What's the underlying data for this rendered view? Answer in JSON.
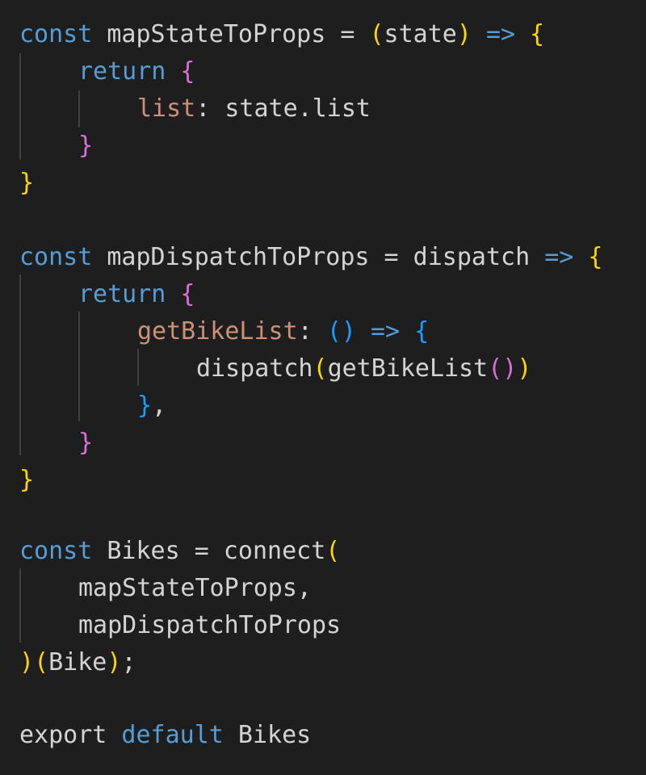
{
  "code": {
    "l1": {
      "kw": "const",
      "rest": " mapStateToProps = ",
      "p1": "(",
      "param": "state",
      "p2": ")",
      "arrow": " =>",
      "brace": " {"
    },
    "l2": {
      "kw": "return",
      "brace": " {"
    },
    "l3": {
      "prop": "list",
      "rest": ": state.list"
    },
    "l4": {
      "brace": "}"
    },
    "l5": {
      "brace": "}"
    },
    "l7": {
      "kw": "const",
      "rest": " mapDispatchToProps = dispatch ",
      "arrow": "=>",
      "brace": " {"
    },
    "l8": {
      "kw": "return",
      "brace": " {"
    },
    "l9": {
      "prop": "getBikeList",
      "colon": ": ",
      "parens": "()",
      "arrow": " =>",
      "brace": " {"
    },
    "l10": {
      "fn": "dispatch",
      "p1": "(",
      "inner": "getBikeList",
      "p2": "()",
      "p3": ")"
    },
    "l11": {
      "brace": "}",
      "rest": ","
    },
    "l12": {
      "brace": "}"
    },
    "l13": {
      "brace": "}"
    },
    "l15": {
      "kw": "const",
      "rest": " Bikes = connect",
      "p1": "("
    },
    "l16": {
      "rest": "mapStateToProps,"
    },
    "l17": {
      "rest": "mapDispatchToProps"
    },
    "l18": {
      "p1": ")",
      "p2": "(",
      "rest": "Bike",
      "p3": ")",
      "semi": ";"
    },
    "l20": {
      "kw1": "export",
      "kw2": " default",
      "rest": " Bikes"
    }
  }
}
